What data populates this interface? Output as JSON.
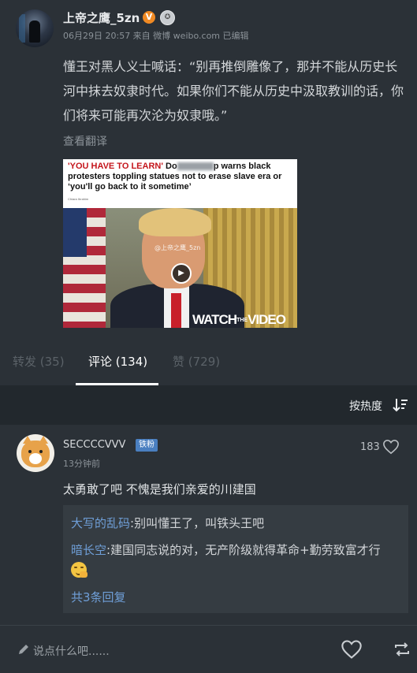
{
  "post": {
    "username": "上帝之鹰_5zn",
    "verified_badge": "V",
    "level_badge_icon": "medal-icon",
    "meta": "06月29日 20:57  来自 微博 weibo.com  已编辑",
    "text": "懂王对黑人义士喊话：“别再推倒雕像了，那并不能从历史长河中抹去奴隶时代。如果你们不能从历史中汲取教训的话，你们将来可能再次沦为奴隶哦。”",
    "translate": "查看翻译",
    "media": {
      "headline_red": "'YOU HAVE TO LEARN'",
      "headline_do": " Do",
      "headline_rest": "p warns black protesters toppling statues not to erase slave era or ‘you'll go back to it sometime’",
      "byline": "Chiara Ibrahim",
      "watermark": "@上帝之鹰_5zn",
      "watch_prefix": "WATCH",
      "watch_the": "THE",
      "watch_suffix": "VIDEO"
    }
  },
  "tabs": {
    "repost": "转发 (35)",
    "comments": "评论 (134)",
    "likes": "赞 (729)"
  },
  "sort": {
    "label": "按热度"
  },
  "comment": {
    "username": "SECCCCVVV",
    "badge": "铁粉",
    "time": "13分钟前",
    "like_count": "183",
    "text": "太勇敢了吧 不愧是我们亲爱的川建国",
    "replies": [
      {
        "name": "大写的乱码",
        "text": ":别叫懂王了，叫铁头王吧"
      },
      {
        "name": "暗长空",
        "text": ":建国同志说的对，无产阶级就得革命+勤劳致富才行"
      }
    ],
    "more_replies": "共3条回复"
  },
  "bottom": {
    "compose_placeholder": "说点什么吧......"
  },
  "colors": {
    "background": "#2b3137",
    "link_blue": "#6f9fd8",
    "verified_orange": "#f08a24"
  }
}
